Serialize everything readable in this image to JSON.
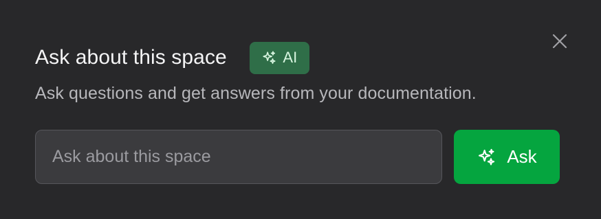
{
  "panel": {
    "title": "Ask about this space",
    "badge": {
      "label": "AI",
      "icon": "sparkles-icon"
    },
    "subtitle": "Ask questions and get answers from your documentation.",
    "close_icon": "close-icon"
  },
  "search": {
    "value": "",
    "placeholder": "Ask about this space"
  },
  "ask_button": {
    "label": "Ask",
    "icon": "sparkles-icon"
  },
  "colors": {
    "background": "#28282a",
    "badge_bg": "#2f6e48",
    "badge_text": "#d7f5df",
    "input_bg": "#3b3b3e",
    "input_border": "#56565b",
    "accent_green": "#05a53f",
    "title_text": "#f4f4f5",
    "subtitle_text": "#b7b7bb"
  }
}
